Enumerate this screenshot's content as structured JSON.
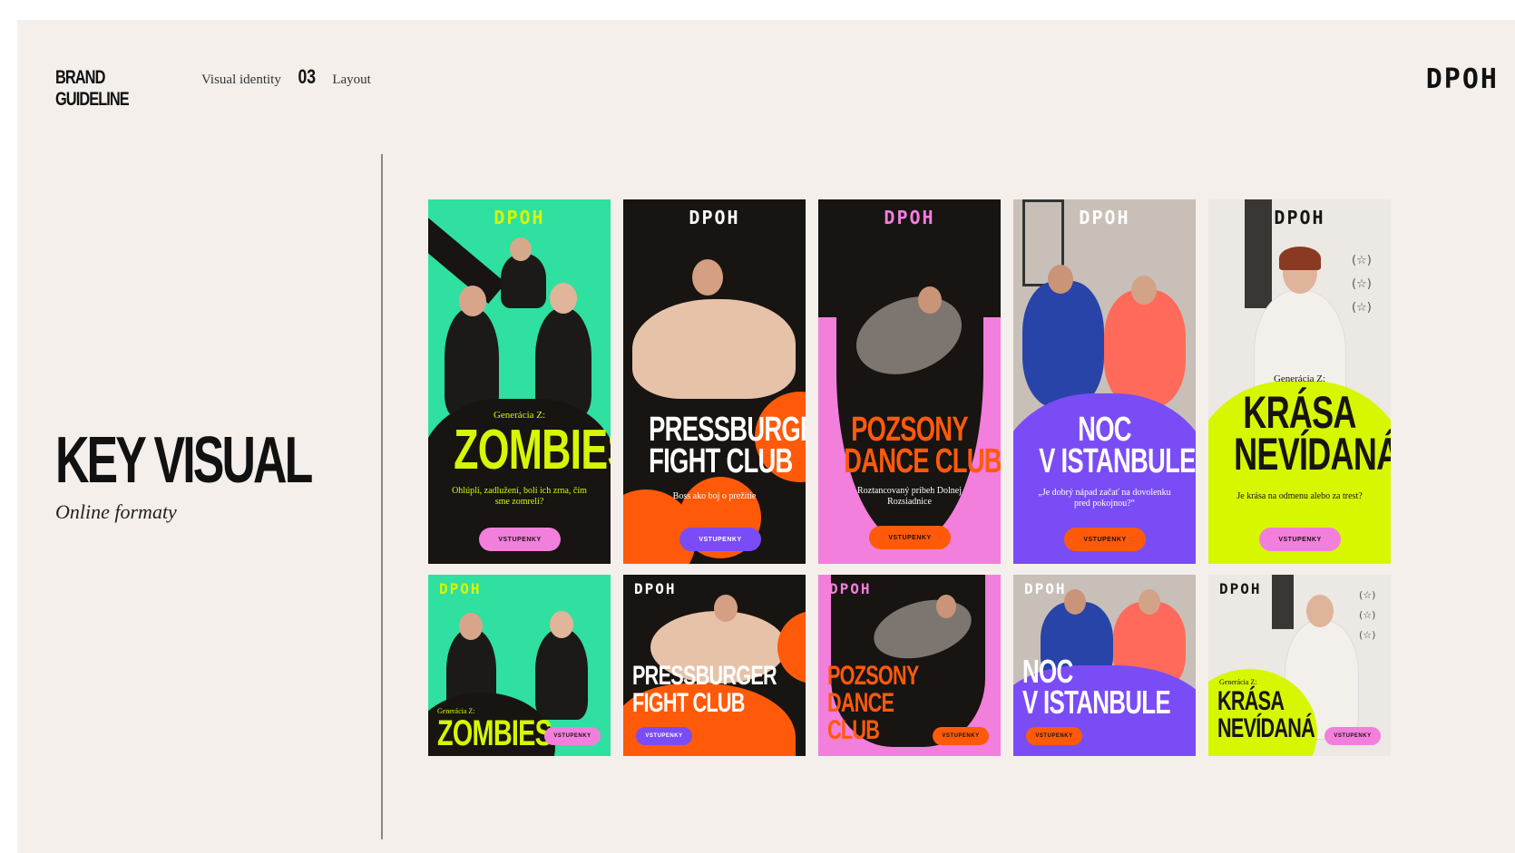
{
  "header": {
    "brand_label": "BRAND GUIDELINE",
    "crumb_section": "Visual identity",
    "section_number": "03",
    "crumb_page": "Layout",
    "logo": "DPOH"
  },
  "hero": {
    "title": "KEY VISUAL",
    "subtitle": "Online formaty"
  },
  "colors": {
    "page_bg": "#f4efeb",
    "green": "#2fe0a0",
    "lime": "#d6f700",
    "orange": "#ff5a0a",
    "pink": "#f27fdc",
    "purple": "#7a4cf5",
    "black": "#171412"
  },
  "tiles": [
    {
      "logo": "DPOH",
      "kicker": "Generácia Z:",
      "title": "ZOMBIES",
      "desc": "Ohlúpli, zadlužení, bolí ich zrna, čím sme zomreli?",
      "button": "VSTUPENKY"
    },
    {
      "logo": "DPOH",
      "title_line1": "PRESSBURGER",
      "title_line2": "FIGHT CLUB",
      "desc": "Boss ako boj o prežitie",
      "button": "VSTUPENKY"
    },
    {
      "logo": "DPOH",
      "title_line1": "POZSONY",
      "title_line2": "DANCE CLUB",
      "desc": "Roztancovaný príbeh Dolnej Rozsiadnice",
      "button": "VSTUPENKY"
    },
    {
      "logo": "DPOH",
      "title_line1": "NOC",
      "title_line2": "V ISTANBULE",
      "desc": "„Je dobrý nápad začať na dovolenku pred pokojnou?“",
      "button": "VSTUPENKY"
    },
    {
      "logo": "DPOH",
      "kicker": "Generácia Z:",
      "title_line1": "KRÁSA",
      "title_line2": "NEVÍDANÁ",
      "desc": "Je krása na odmenu alebo za trest?",
      "button": "VSTUPENKY"
    }
  ],
  "tiles_small": [
    {
      "logo": "DPOH",
      "kicker": "Generácia Z:",
      "title": "ZOMBIES",
      "button": "VSTUPENKY"
    },
    {
      "logo": "DPOH",
      "title_line1": "PRESSBURGER",
      "title_line2": "FIGHT CLUB",
      "button": "VSTUPENKY"
    },
    {
      "logo": "DPOH",
      "title_line1": "POZSONY",
      "title_line2": "DANCE",
      "title_line3": "CLUB",
      "button": "VSTUPENKY"
    },
    {
      "logo": "DPOH",
      "title_line1": "NOC",
      "title_line2": "V ISTANBULE",
      "button": "VSTUPENKY"
    },
    {
      "logo": "DPOH",
      "kicker": "Generácia Z:",
      "title_line1": "KRÁSA",
      "title_line2": "NEVÍDANÁ",
      "button": "VSTUPENKY"
    }
  ]
}
